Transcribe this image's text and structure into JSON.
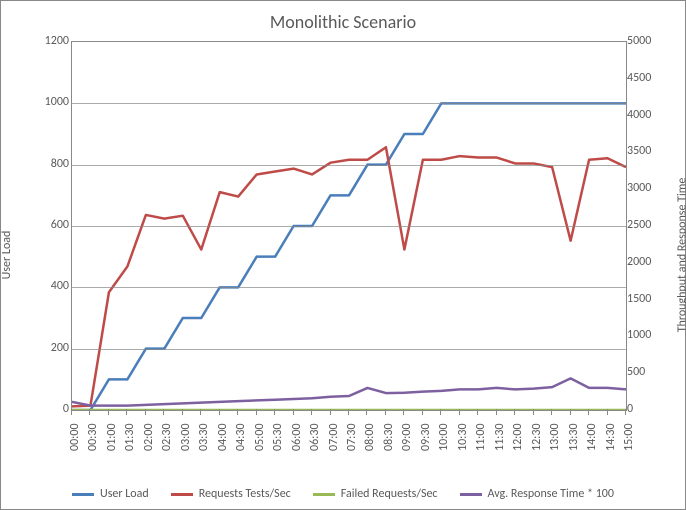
{
  "chart_data": {
    "type": "line",
    "title": "Monolithic Scenario",
    "xlabel": "",
    "y_left_label": "User Load",
    "y_right_label": "Throughput and Response Time",
    "y_left_range": [
      0,
      1200
    ],
    "y_right_range": [
      0,
      5000
    ],
    "y_left_ticks": [
      0,
      200,
      400,
      600,
      800,
      1000,
      1200
    ],
    "y_right_ticks": [
      0,
      500,
      1000,
      1500,
      2000,
      2500,
      3000,
      3500,
      4000,
      4500,
      5000
    ],
    "categories": [
      "00:00",
      "00:30",
      "01:00",
      "01:30",
      "02:00",
      "02:30",
      "03:00",
      "03:30",
      "04:00",
      "04:30",
      "05:00",
      "05:30",
      "06:00",
      "06:30",
      "07:00",
      "07:30",
      "08:00",
      "08:30",
      "09:00",
      "09:30",
      "10:00",
      "10:30",
      "11:00",
      "11:30",
      "12:00",
      "12:30",
      "13:00",
      "13:30",
      "14:00",
      "14:30",
      "15:00"
    ],
    "series": [
      {
        "name": "User Load",
        "axis": "left",
        "color": "#4A7EBB",
        "values": [
          0,
          0,
          100,
          100,
          200,
          200,
          300,
          300,
          400,
          400,
          500,
          500,
          600,
          600,
          700,
          700,
          800,
          800,
          900,
          900,
          1000,
          1000,
          1000,
          1000,
          1000,
          1000,
          1000,
          1000,
          1000,
          1000,
          1000
        ]
      },
      {
        "name": "Requests Tests/Sec",
        "axis": "right",
        "color": "#BE4B48",
        "values": [
          50,
          60,
          1600,
          1950,
          2650,
          2600,
          2640,
          2180,
          2960,
          2900,
          3200,
          3240,
          3280,
          3200,
          3360,
          3400,
          3400,
          3570,
          2180,
          3400,
          3400,
          3450,
          3430,
          3430,
          3350,
          3350,
          3300,
          2300,
          3400,
          3420,
          3300
        ]
      },
      {
        "name": "Failed Requests/Sec",
        "axis": "right",
        "color": "#98B954",
        "values": [
          0,
          0,
          0,
          0,
          0,
          0,
          0,
          0,
          0,
          0,
          0,
          0,
          0,
          0,
          0,
          0,
          0,
          0,
          0,
          0,
          0,
          0,
          0,
          0,
          0,
          0,
          0,
          0,
          0,
          0,
          0
        ]
      },
      {
        "name": "Avg. Response Time * 100",
        "axis": "right",
        "color": "#7D60A0",
        "values": [
          110,
          60,
          60,
          60,
          70,
          80,
          90,
          100,
          110,
          120,
          130,
          140,
          150,
          160,
          180,
          190,
          300,
          230,
          235,
          250,
          260,
          280,
          280,
          300,
          280,
          290,
          310,
          430,
          300,
          300,
          280
        ]
      }
    ]
  }
}
